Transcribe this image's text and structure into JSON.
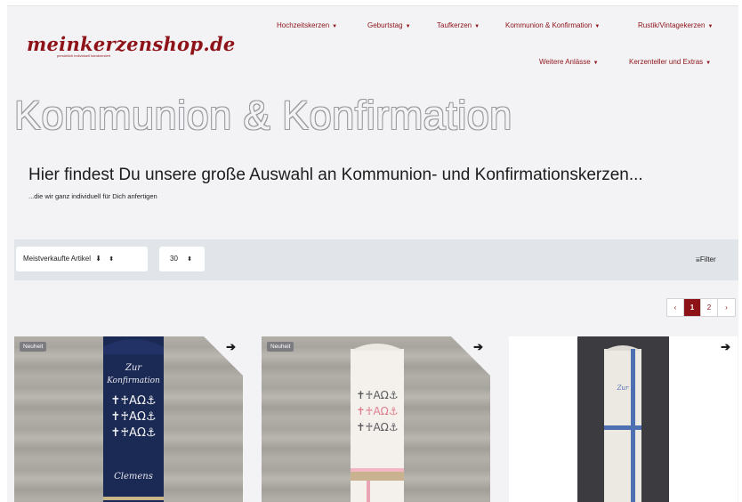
{
  "brand": {
    "logo": "meinkerzenshop.de",
    "tagline": "persönlich   individuell   handverziert"
  },
  "nav": {
    "row1": [
      {
        "label": "Hochzeitskerzen"
      },
      {
        "label": "Geburtstag"
      },
      {
        "label": "Taufkerzen"
      },
      {
        "label": "Kommunion & Konfirmation"
      },
      {
        "label": "Rustik/Vintagekerzen"
      }
    ],
    "row2": [
      {
        "label": "Weitere Anlässe"
      },
      {
        "label": "Kerzenteller und Extras"
      }
    ],
    "caret": "▼"
  },
  "hero": {
    "title": "Kommunion & Konfirmation",
    "headline": "Hier findest Du unsere große Auswahl an Kommunion- und Konfirmationskerzen...",
    "subline": "...die wir ganz individuell für Dich anfertigen"
  },
  "toolbar": {
    "sort_label": "Meistverkaufte Artikel",
    "sort_dir_icon": "⬇",
    "per_page": "30",
    "select_arrows": "⬍",
    "filter_label": "Filter",
    "filter_icon": "⩸"
  },
  "pagination": {
    "prev": "‹",
    "pages": [
      "1",
      "2"
    ],
    "current": "1",
    "next": "›"
  },
  "products": [
    {
      "badge": "Neuheit",
      "arrow": "➔",
      "candle_text_top": "Zur",
      "candle_text_mid": "Konfirmation",
      "candle_name": "Clemens",
      "candle_symbols": "✝♰ΑΩ⚓"
    },
    {
      "badge": "Neuheit",
      "arrow": "➔",
      "candle_symbols": "✝♰ΑΩ⚓"
    },
    {
      "arrow": "➔",
      "candle_text_top": "Zur"
    }
  ],
  "colors": {
    "brand": "#8e1318",
    "page_bg": "#f3f3f6",
    "toolbar_bg": "#e1e4e8",
    "candle_navy": "#1b2a55"
  }
}
